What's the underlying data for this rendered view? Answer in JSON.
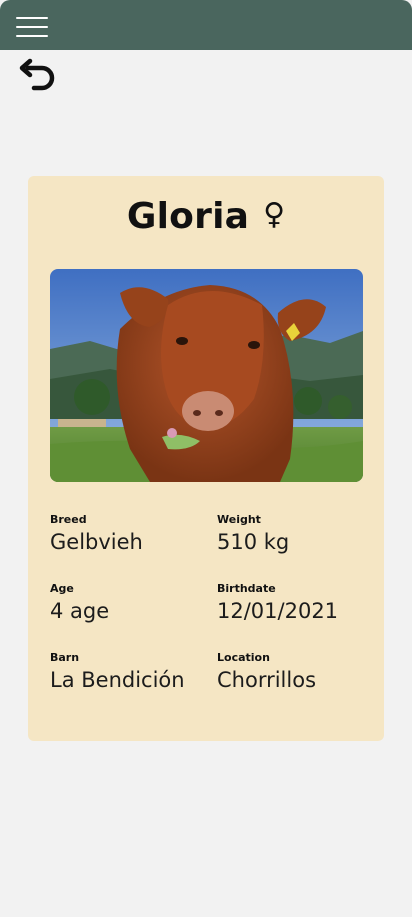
{
  "header": {
    "menu_icon": "hamburger-menu-icon",
    "bar_color": "#4a665e"
  },
  "navigation": {
    "back_icon": "undo-arrow-icon"
  },
  "animal": {
    "name": "Gloria",
    "sex_symbol": "♀",
    "photo": "brown cow in a green pasture with mountains",
    "card_color": "#f5e6c4",
    "fields": {
      "breed": {
        "label": "Breed",
        "value": "Gelbvieh"
      },
      "weight": {
        "label": "Weight",
        "value": "510 kg"
      },
      "age": {
        "label": "Age",
        "value": "4 age"
      },
      "birthdate": {
        "label": "Birthdate",
        "value": "12/01/2021"
      },
      "barn": {
        "label": "Barn",
        "value": "La Bendición"
      },
      "location": {
        "label": "Location",
        "value": "Chorrillos"
      }
    }
  }
}
